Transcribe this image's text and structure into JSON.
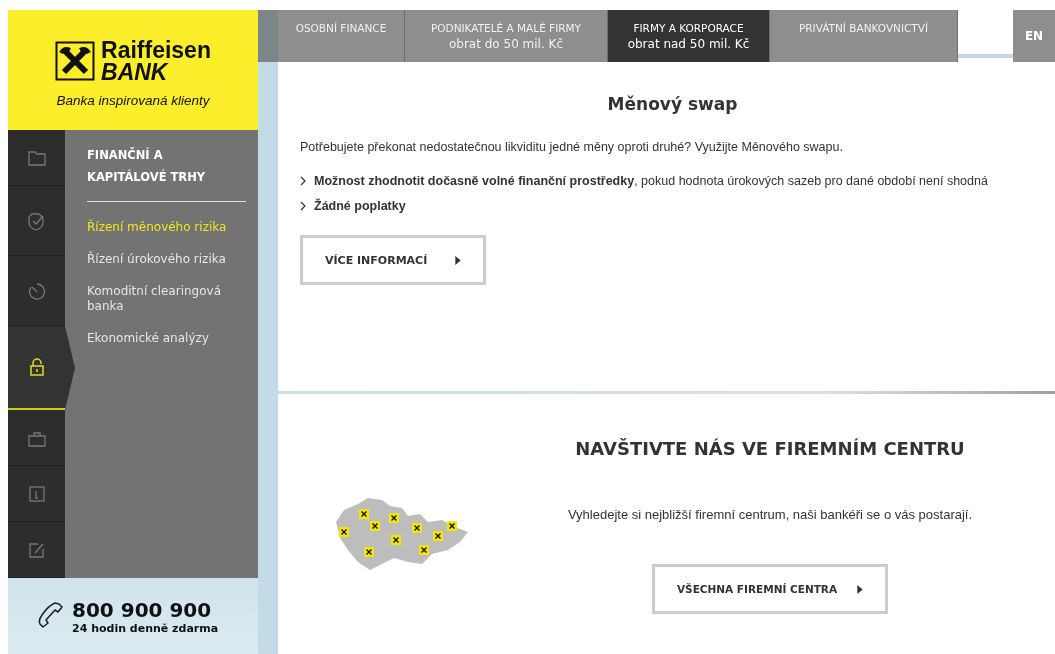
{
  "logo": {
    "name": "Raiffeisen",
    "subname": "BANK",
    "tagline": "Banka inspirovaná klienty"
  },
  "top_nav": {
    "tabs": [
      {
        "label": "OSOBNÍ FINANCE",
        "selected": false
      },
      {
        "label": "PODNIKATELÉ A MALÉ FIRMY",
        "sublabel": "obrat do 50 mil. Kč",
        "selected": false
      },
      {
        "label": "FIRMY A KORPORACE",
        "sublabel": "obrat nad 50 mil. Kč",
        "selected": true
      },
      {
        "label": "PRIVÁTNÍ BANKOVNICTVÍ",
        "selected": false
      }
    ],
    "language": "EN"
  },
  "sidebar": {
    "icon_tabs": [
      {
        "selected": false
      },
      {
        "selected": false
      },
      {
        "selected": false
      },
      {
        "selected": true
      },
      {
        "selected": false
      },
      {
        "selected": false
      },
      {
        "selected": false
      }
    ],
    "heading": "FINANČNÍ A KAPITÁLOVÉ TRHY",
    "items": [
      {
        "label": "Řízení měnového rizika",
        "selected": true
      },
      {
        "label": "Řízení úrokového rizika",
        "selected": false
      },
      {
        "label": "Komoditní clearingová banka",
        "selected": false
      },
      {
        "label": "Ekonomické analýzy",
        "selected": false
      }
    ]
  },
  "phone": {
    "number": "800 900 900",
    "note": "24 hodin denně zdarma"
  },
  "product": {
    "title": "Měnový swap",
    "intro": "Potřebujete překonat nedostatečnou likviditu jedné měny oproti druhé? Využijte Měnového swapu.",
    "bullets": [
      {
        "text": "**Možnost zhodnotit dočasně volné finanční prostředky**, pokud hodnota úrokových sazeb pro dané období není shodná",
        "bold": false
      },
      {
        "text": "Žádné poplatky",
        "bold": true
      }
    ],
    "button": "VÍCE INFORMACÍ"
  },
  "centers": {
    "title": "NAVŠTIVTE NÁS VE FIREMNÍM CENTRU",
    "text": "Vyhledejte si nejbližší firemní centrum, naši bankéři se o vás postarají.",
    "button": "VŠECHNA FIREMNÍ CENTRA"
  }
}
